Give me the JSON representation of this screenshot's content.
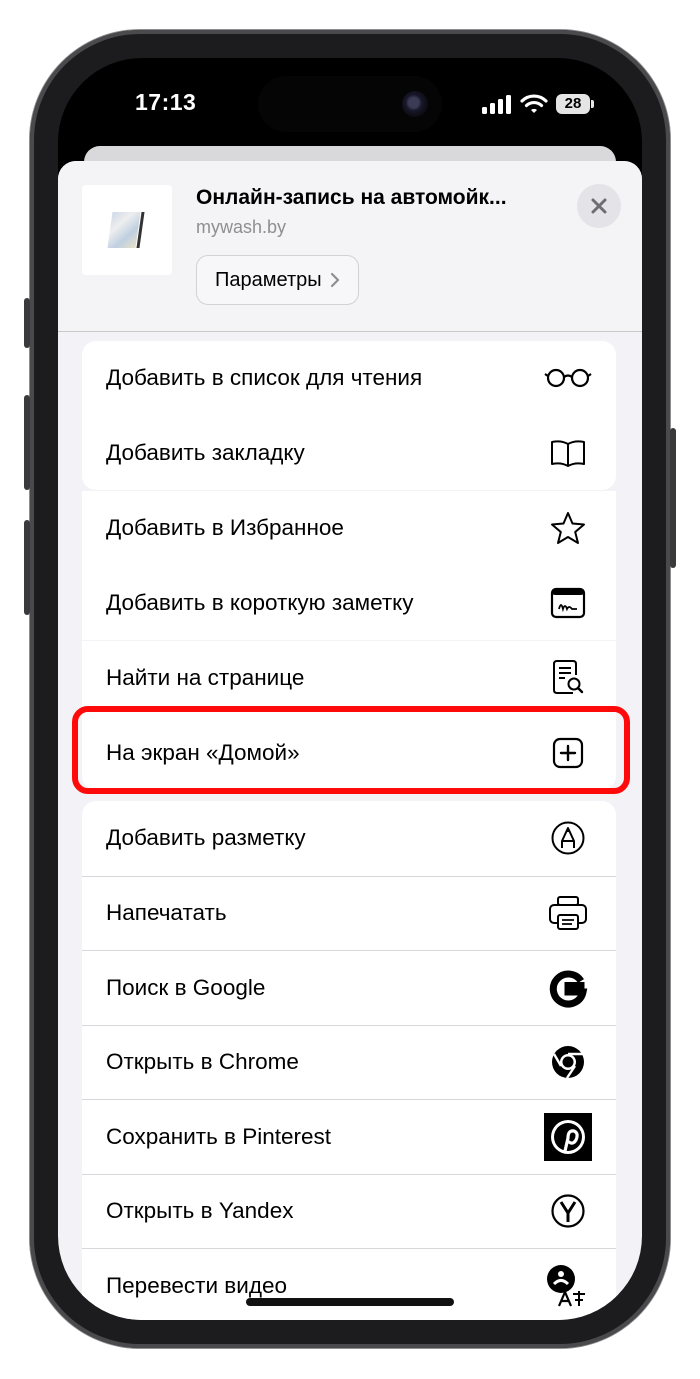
{
  "status_bar": {
    "time": "17:13",
    "battery": "28"
  },
  "share_sheet": {
    "page_title": "Онлайн-запись на автомойк...",
    "page_url": "mywash.by",
    "options_button": "Параметры"
  },
  "actions": [
    {
      "label": "Добавить в список для чтения",
      "icon": "glasses-icon"
    },
    {
      "label": "Добавить закладку",
      "icon": "book-icon"
    },
    {
      "label": "Добавить в Избранное",
      "icon": "star-icon"
    },
    {
      "label": "Добавить в короткую заметку",
      "icon": "quick-note-icon"
    },
    {
      "label": "Найти на странице",
      "icon": "find-in-page-icon"
    },
    {
      "label": "На экран «Домой»",
      "icon": "add-square-icon"
    },
    {
      "label": "Добавить разметку",
      "icon": "markup-pen-icon"
    },
    {
      "label": "Напечатать",
      "icon": "printer-icon"
    },
    {
      "label": "Поиск в Google",
      "icon": "google-icon"
    },
    {
      "label": "Открыть в Chrome",
      "icon": "chrome-icon"
    },
    {
      "label": "Сохранить в Pinterest",
      "icon": "pinterest-icon"
    },
    {
      "label": "Открыть в Yandex",
      "icon": "yandex-icon"
    },
    {
      "label": "Перевести видео",
      "icon": "translate-video-icon"
    }
  ],
  "colors": {
    "highlight": "#ff0a0a",
    "sheet_bg": "#f2f2f7"
  }
}
